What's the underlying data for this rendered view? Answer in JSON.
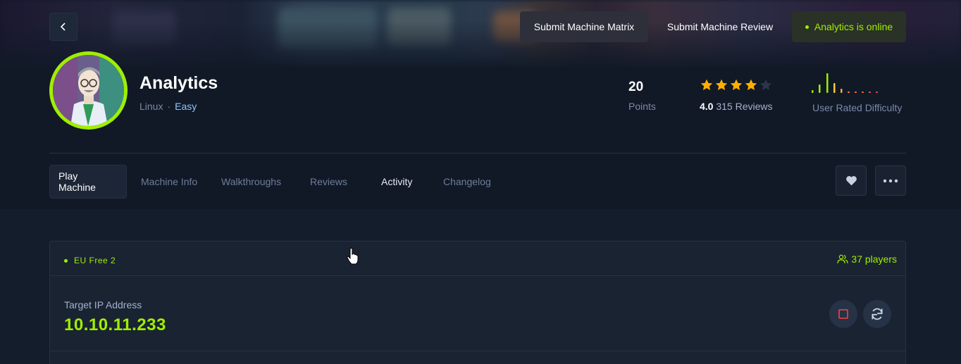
{
  "header": {
    "submit_matrix": "Submit Machine Matrix",
    "submit_review": "Submit Machine Review",
    "online_status": "Analytics is online"
  },
  "machine": {
    "name": "Analytics",
    "os": "Linux",
    "separator": "·",
    "difficulty": "Easy",
    "points_value": "20",
    "points_label": "Points",
    "rating_value": "4.0",
    "rating_stars": 4,
    "reviews_count": "315 Reviews",
    "user_difficulty_label": "User Rated Difficulty"
  },
  "tabs": [
    {
      "label": "Play Machine"
    },
    {
      "label": "Machine Info"
    },
    {
      "label": "Walkthroughs"
    },
    {
      "label": "Reviews"
    },
    {
      "label": "Activity"
    },
    {
      "label": "Changelog"
    }
  ],
  "server": {
    "name": "EU Free 2",
    "players": "37 players"
  },
  "target": {
    "label": "Target IP Address",
    "ip": "10.10.11.233"
  },
  "colors": {
    "accent": "#9fef00",
    "background": "#141d2b",
    "star": "#ffaf00",
    "stop": "#ff3e3e"
  }
}
